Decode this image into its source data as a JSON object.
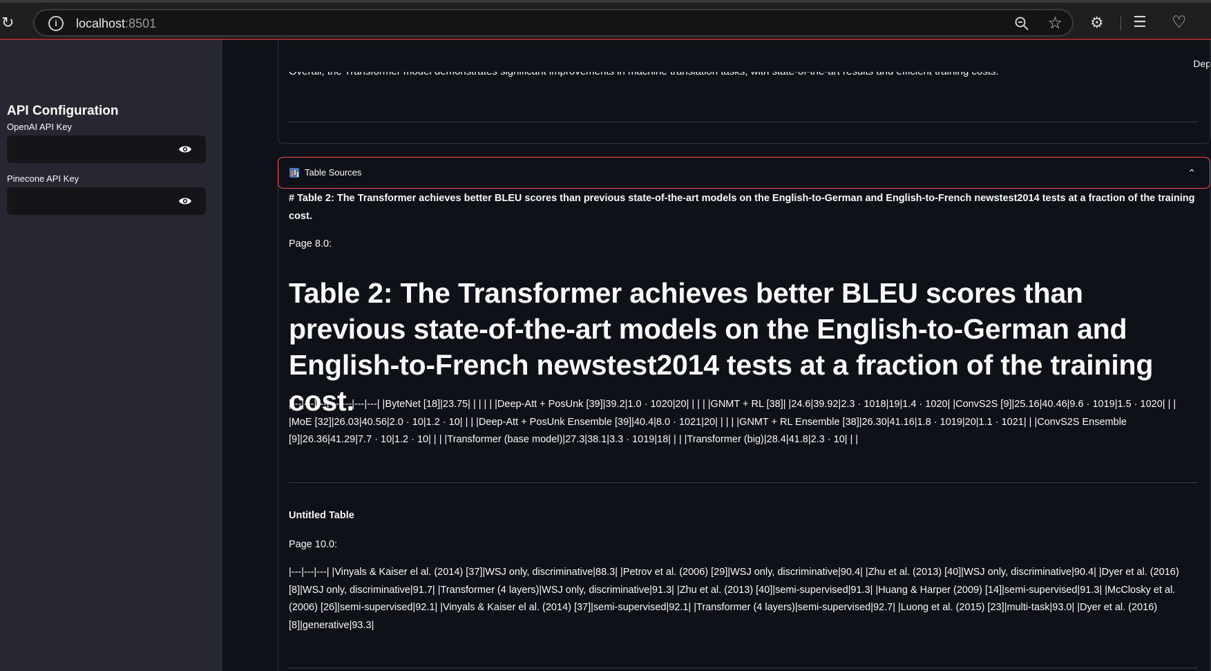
{
  "browser": {
    "url_host": "localhost",
    "url_port": ":8501"
  },
  "sidebar": {
    "title": "API Configuration",
    "fields": [
      {
        "label": "OpenAI API Key"
      },
      {
        "label": "Pinecone API Key"
      }
    ]
  },
  "main": {
    "deploy_label": "Dep",
    "summary_cut": "Overall, the Transformer model demonstrates significant improvements in machine translation tasks, with state-of-the-art results and efficient training costs.",
    "expander": {
      "label": "Table Sources",
      "icon": "bar-chart-icon"
    },
    "table2": {
      "markdown_line": "# Table 2: The Transformer achieves better BLEU scores than previous state-of-the-art models on the English-to-German and English-to-French newstest2014 tests at a fraction of the training cost.",
      "page": "Page 8.0:",
      "heading": "Table 2: The Transformer achieves better BLEU scores than previous state-of-the-art models on the English-to-German and English-to-French newstest2014 tests at a fraction of the training cost.",
      "raw": "|---|---|---|---|---|---|---| |ByteNet [18]|23.75| | | | | |Deep-Att + PosUnk [39]|39.2|1.0 · 1020|20| | | | |GNMT + RL [38]| |24.6|39.92|2.3 · 1018|19|1.4 · 1020| |ConvS2S [9]|25.16|40.46|9.6 · 1019|1.5 · 1020| | | |MoE [32]|26.03|40.56|2.0 · 10|1.2 · 10| | | |Deep-Att + PosUnk Ensemble [39]|40.4|8.0 · 1021|20| | | | |GNMT + RL Ensemble [38]|26.30|41.16|1.8 · 1019|20|1.1 · 1021| | |ConvS2S Ensemble [9]|26.36|41.29|7.7 · 10|1.2 · 10| | | |Transformer (base model)|27.3|38.1|3.3 · 1019|18| | | |Transformer (big)|28.4|41.8|2.3 · 10| | |"
    },
    "untitled": {
      "title": "Untitled Table",
      "page": "Page 10.0:",
      "raw": "|---|---|---| |Vinyals & Kaiser el al. (2014) [37]|WSJ only, discriminative|88.3| |Petrov et al. (2006) [29]|WSJ only, discriminative|90.4| |Zhu et al. (2013) [40]|WSJ only, discriminative|90.4| |Dyer et al. (2016) [8]|WSJ only, discriminative|91.7| |Transformer (4 layers)|WSJ only, discriminative|91.3| |Zhu et al. (2013) [40]|semi-supervised|91.3| |Huang & Harper (2009) [14]|semi-supervised|91.3| |McClosky et al. (2006) [26]|semi-supervised|92.1| |Vinyals & Kaiser el al. (2014) [37]|semi-supervised|92.1| |Transformer (4 layers)|semi-supervised|92.7| |Luong et al. (2015) [23]|multi-task|93.0| |Dyer et al. (2016) [8]|generative|93.3|"
    }
  }
}
